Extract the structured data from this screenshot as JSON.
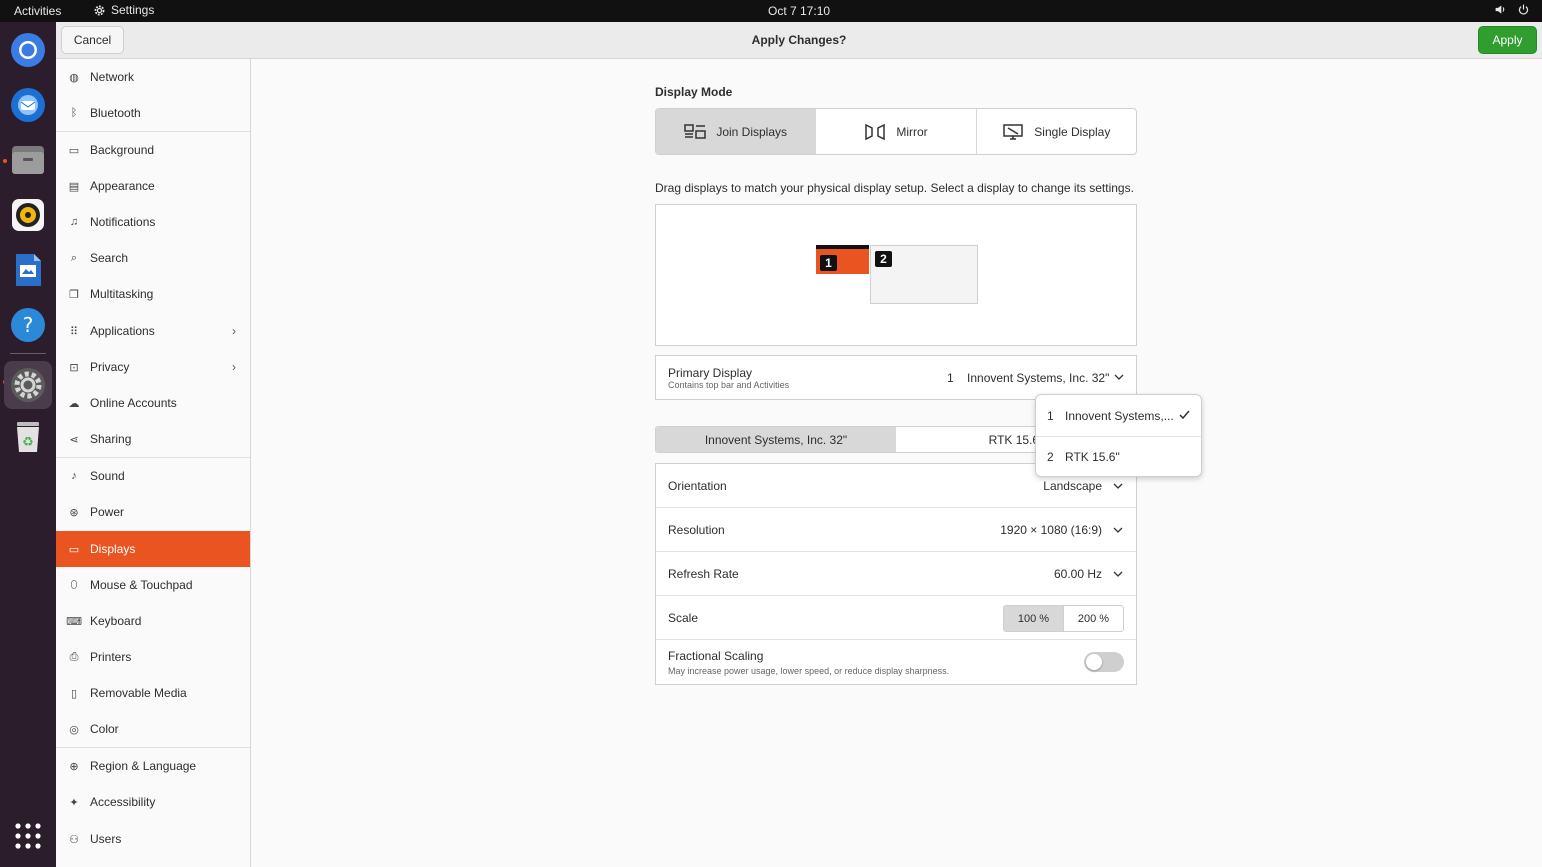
{
  "topbar": {
    "activities": "Activities",
    "app_name": "Settings",
    "clock": "Oct 7  17:10",
    "icons": [
      "settings-gear-icon",
      "speaker-icon",
      "power-icon"
    ]
  },
  "dock": {
    "items": [
      {
        "name": "chromium",
        "icon": "chromium-icon",
        "color": "#1a73e8"
      },
      {
        "name": "thunderbird",
        "icon": "thunderbird-icon",
        "color": "#2b7bd6"
      },
      {
        "name": "files",
        "icon": "files-icon",
        "color": "#8b8b8b"
      },
      {
        "name": "rhythmbox",
        "icon": "rhythmbox-icon",
        "color": "#f1c40f"
      },
      {
        "name": "libreoffice-writer",
        "icon": "writer-icon",
        "color": "#2a6fc9"
      },
      {
        "name": "help",
        "icon": "help-icon",
        "color": "#2a8ad8"
      },
      {
        "name": "settings",
        "icon": "settings-icon",
        "color": "#9a9a9a"
      },
      {
        "name": "trash",
        "icon": "trash-icon",
        "color": "#4caf50"
      },
      {
        "name": "show-apps",
        "icon": "app-grid-icon",
        "color": "#ffffff"
      }
    ]
  },
  "header": {
    "cancel": "Cancel",
    "title": "Apply Changes?",
    "apply": "Apply",
    "apply_color": "#2f9e2f"
  },
  "sidebar": {
    "accent": "#e95420",
    "items": [
      {
        "label": "Network",
        "icon": "network-icon"
      },
      {
        "label": "Bluetooth",
        "icon": "bluetooth-icon"
      },
      {
        "label": "Background",
        "icon": "background-icon"
      },
      {
        "label": "Appearance",
        "icon": "appearance-icon"
      },
      {
        "label": "Notifications",
        "icon": "notifications-icon"
      },
      {
        "label": "Search",
        "icon": "search-icon"
      },
      {
        "label": "Multitasking",
        "icon": "multitasking-icon"
      },
      {
        "label": "Applications",
        "icon": "applications-icon"
      },
      {
        "label": "Privacy",
        "icon": "privacy-icon"
      },
      {
        "label": "Online Accounts",
        "icon": "online-accounts-icon"
      },
      {
        "label": "Sharing",
        "icon": "sharing-icon"
      },
      {
        "label": "Sound",
        "icon": "sound-icon"
      },
      {
        "label": "Power",
        "icon": "power-icon"
      },
      {
        "label": "Displays",
        "icon": "displays-icon"
      },
      {
        "label": "Mouse & Touchpad",
        "icon": "mouse-icon"
      },
      {
        "label": "Keyboard",
        "icon": "keyboard-icon"
      },
      {
        "label": "Printers",
        "icon": "printer-icon"
      },
      {
        "label": "Removable Media",
        "icon": "removable-media-icon"
      },
      {
        "label": "Color",
        "icon": "color-icon"
      },
      {
        "label": "Region & Language",
        "icon": "region-icon"
      },
      {
        "label": "Accessibility",
        "icon": "accessibility-icon"
      },
      {
        "label": "Users",
        "icon": "users-icon"
      }
    ],
    "selected": "Displays"
  },
  "display_mode": {
    "title": "Display Mode",
    "options": [
      "Join Displays",
      "Mirror",
      "Single Display"
    ],
    "selected": "Join Displays"
  },
  "arrangement": {
    "instructions": "Drag displays to match your physical display setup. Select a display to change its settings.",
    "monitor1": "1",
    "monitor2": "2"
  },
  "primary_display": {
    "label": "Primary Display",
    "sub": "Contains top bar and Activities",
    "value": "1    Innovent Systems, Inc. 32\""
  },
  "popover": {
    "items": [
      {
        "num": "1",
        "name": "Innovent Systems,..."
      },
      {
        "num": "2",
        "name": "RTK 15.6\""
      }
    ]
  },
  "monitor_tabs": [
    "Innovent Systems, Inc. 32\"",
    "RTK 15.6\""
  ],
  "settings": {
    "orientation": {
      "label": "Orientation",
      "value": "Landscape"
    },
    "resolution": {
      "label": "Resolution",
      "value": "1920 × 1080 (16:9)"
    },
    "refresh": {
      "label": "Refresh Rate",
      "value": "60.00 Hz"
    },
    "scale": {
      "label": "Scale",
      "options": [
        "100 %",
        "200 %"
      ],
      "selected": "100 %"
    },
    "fractional": {
      "label": "Fractional Scaling",
      "sub": "May increase power usage, lower speed, or reduce display sharpness.",
      "enabled": false
    }
  }
}
